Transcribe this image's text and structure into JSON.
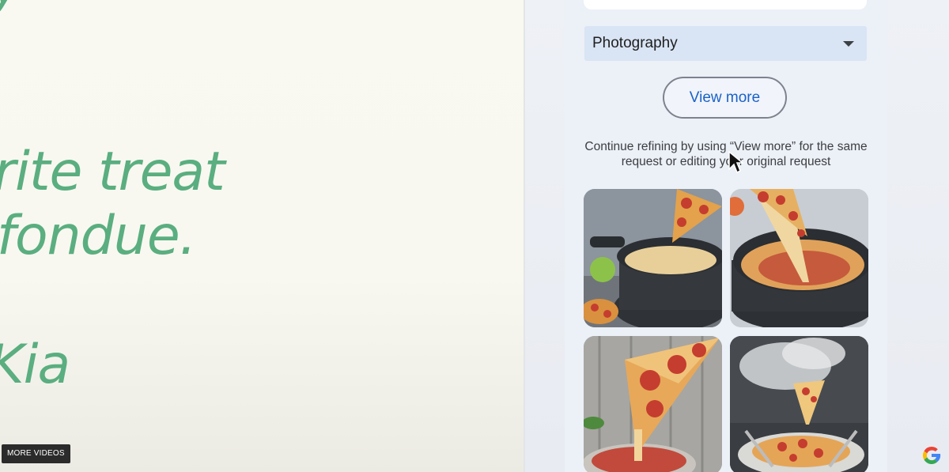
{
  "slide": {
    "lines": [
      "y",
      "rite treat",
      "fondue.",
      "Kia"
    ]
  },
  "player": {
    "more_videos_label": "MORE VIDEOS"
  },
  "panel": {
    "style_select_value": "Photography",
    "view_more_label": "View more",
    "hint_text": "Continue refining by using “View more” for the same request or editing your original request"
  },
  "images": [
    {
      "alt": "generated image 1"
    },
    {
      "alt": "generated image 2"
    },
    {
      "alt": "generated image 3"
    },
    {
      "alt": "generated image 4"
    }
  ],
  "icons": {
    "dropdown": "chevron-down-icon",
    "brand": "google-icon",
    "pointer": "mouse-cursor-icon"
  },
  "colors": {
    "slide_text": "#5aae7f",
    "accent": "#1a62c8",
    "select_bg": "#d9e4f4"
  }
}
